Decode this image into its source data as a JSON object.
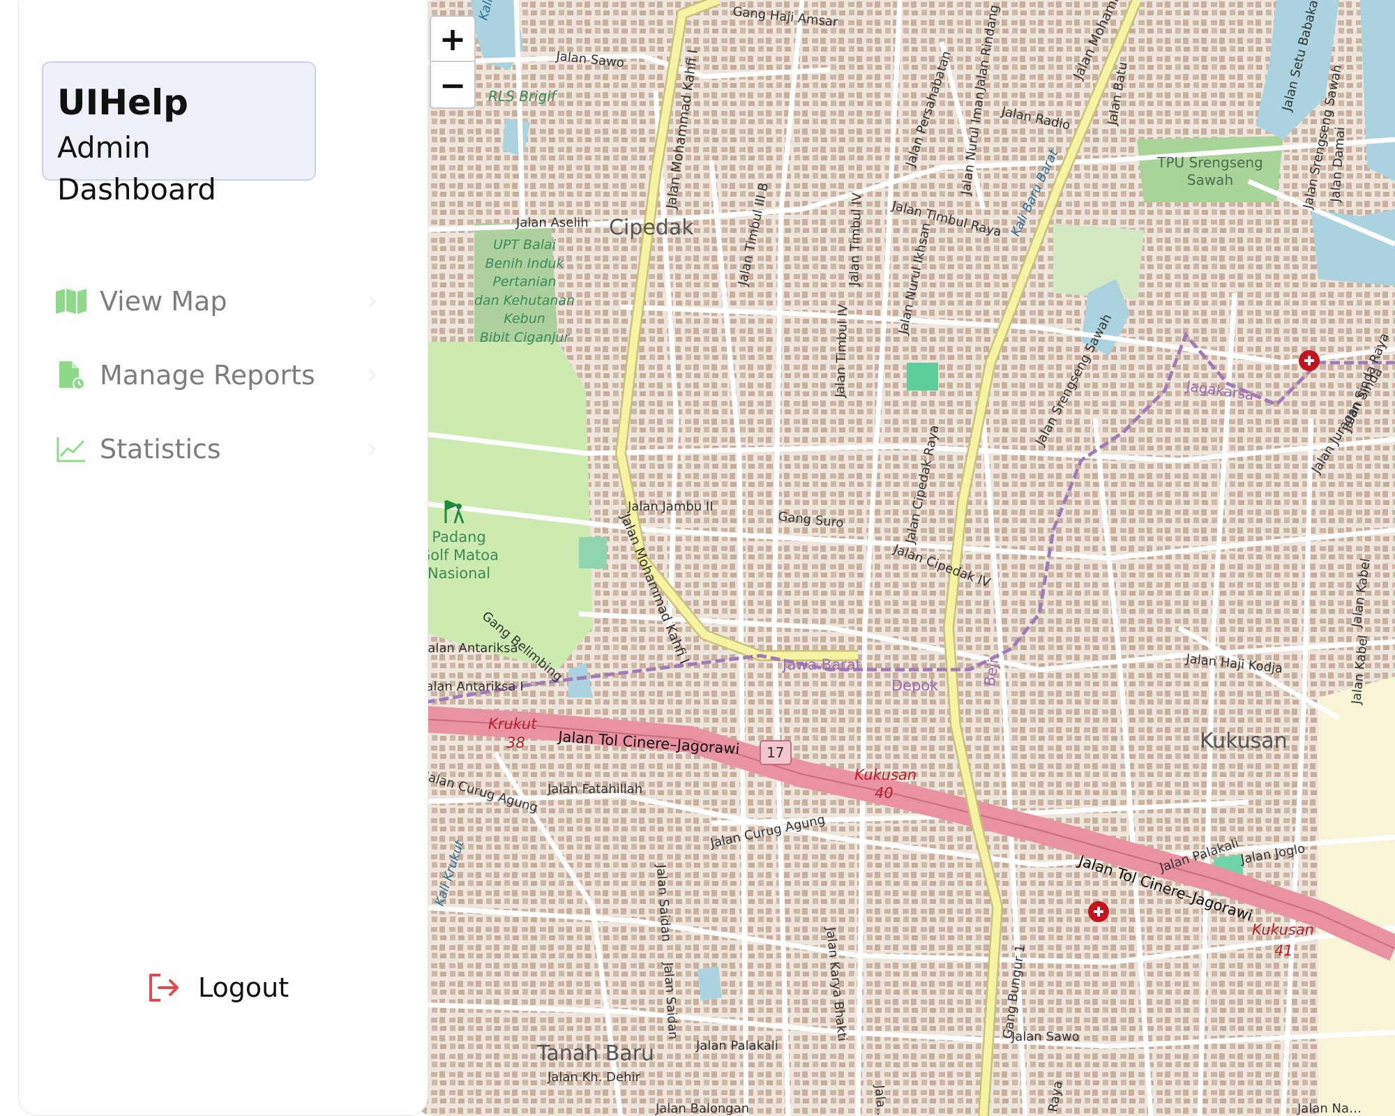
{
  "brand": {
    "title": "UIHelp",
    "subtitle": "Admin Dashboard"
  },
  "nav": {
    "items": [
      {
        "label": "View Map",
        "icon": "map-icon"
      },
      {
        "label": "Manage Reports",
        "icon": "report-file-icon"
      },
      {
        "label": "Statistics",
        "icon": "chart-line-icon"
      }
    ]
  },
  "logout": {
    "label": "Logout",
    "icon": "logout-icon"
  },
  "colors": {
    "accent_green": "#8ed98a",
    "logout_red": "#e5484d",
    "motorway": "#e892a2",
    "primary_road": "#f7f3a5",
    "water": "#aad3df",
    "park": "#cdebb0"
  },
  "map": {
    "zoom_in": "+",
    "zoom_out": "−",
    "labels": {
      "gang_haji_amsar": "Gang Haji Amsar",
      "jalan_sawo_top": "Jalan Sawo",
      "rls_brigif": "RLS Brigif",
      "kali_krukut_top": "Kali Krukut",
      "jalan_mohammad_kahfi_top": "Jalan Mohammad Kahfi I",
      "jalan_mohammad_kahfi_mid": "Jalan Mohammad Kahfi I",
      "jalan_mohammad_kahfi_right": "Jalan Mohammad Kahfi II",
      "jalan_aselih": "Jalan Aselih",
      "cipedak": "Cipedak",
      "upt_1": "UPT Balai",
      "upt_2": "Benih Induk",
      "upt_3": "Pertanian",
      "upt_4": "dan Kehutanan",
      "upt_5": "Kebun",
      "upt_6": "Bibit Ciganjur",
      "jalan_timbul_iii_b": "Jalan Timbul III B",
      "jalan_timbul_iv_a": "Jalan Timbul IV",
      "jalan_timbul_iv_b": "Jalan Timbul IV",
      "jalan_persahabatan": "Jalan Persahabatan",
      "jalan_rindang": "Jalan Rindang",
      "jalan_radio": "Jalan Radio",
      "jalan_batu": "Jalan Batu",
      "jalan_nurul_iman": "Jalan Nurul Iman",
      "jalan_nurul_ikhsan": "Jalan Nurul Ikhsan",
      "jalan_timbul_raya": "Jalan Timbul Raya",
      "kali_baru_barat": "Kali Baru Barat",
      "tpu_1": "TPU Srengseng",
      "tpu_2": "Sawah",
      "jalan_srengseng_sawah": "Jalan Srengseng Sawah",
      "jalan_srengseng_sawah_top": "Jalan Srengseng Sawah",
      "jalan_setu_babakan": "Jalan Setu Babakan",
      "jalan_damai": "Jalan Damai",
      "jagakarsa": "Jagakarsa",
      "jalan_sinda_raya": "Jalan Sinda Raya",
      "jalan_juragan_sinda": "Jalan Juragan Sinda",
      "jalan_jambu_ii": "Jalan Jambu II",
      "gang_suro": "Gang Suro",
      "jalan_cipedak_raya": "Jalan Cipedak Raya",
      "jalan_cipedak_iv": "Jalan Cipedak IV",
      "golf_1": "Padang",
      "golf_2": "Golf Matoa",
      "golf_3": "Nasional",
      "gang_belimbing": "Gang Belimbing",
      "jalan_antariksa": "Jalan Antariksa",
      "jalan_antariksa_i": "Jalan Antariksa I",
      "jawa_barat": "Jawa Barat",
      "depok": "Depok",
      "beji": "Beji",
      "jalan_haji_kodja": "Jalan Haji Kodja",
      "kukusan": "Kukusan",
      "jalan_kabel_upper": "Jalan Kabel",
      "jalan_kabel_lower": "Jalan Kabel",
      "krukut_38": "Krukut",
      "num_38": "38",
      "tol_1": "Jalan Tol Cinere–Jagorawi",
      "shield_17": "17",
      "kukusan_40": "Kukusan",
      "num_40": "40",
      "jalan_curug_agung_left": "Jalan Curug Agung",
      "jalan_fatahillah": "Jalan Fatahillah",
      "jalan_curug_agung_mid": "Jalan Curug Agung",
      "tol_2": "Jalan Tol Cinere–Jagorawi",
      "kukusan_41": "Kukusan",
      "num_41": "41",
      "jalan_palakali_right": "Jalan Palakali",
      "jalan_joglo": "Jalan Joglo",
      "kali_krukut_bottom": "Kali Krukut",
      "jalan_saidan_a": "Jalan Saidan",
      "jalan_saidan_b": "Jalan Saidan",
      "jalan_karya_bhakti": "Jalan Karya Bhakti",
      "gang_bungur": "Gang Bungur 1",
      "jalan_sawo_bottom": "Jalan Sawo",
      "tanah_baru": "Tanah Baru",
      "jalan_palakali": "Jalan Palakali",
      "jalan_kh_dehir": "Jalan Kh. Dehir",
      "jalan_balongan": "Jalan Balongan",
      "jalan_bottom_right": "Jalan Na…",
      "jalan_bottom_center": "Jala…",
      "raya_bottom": "Raya"
    }
  }
}
